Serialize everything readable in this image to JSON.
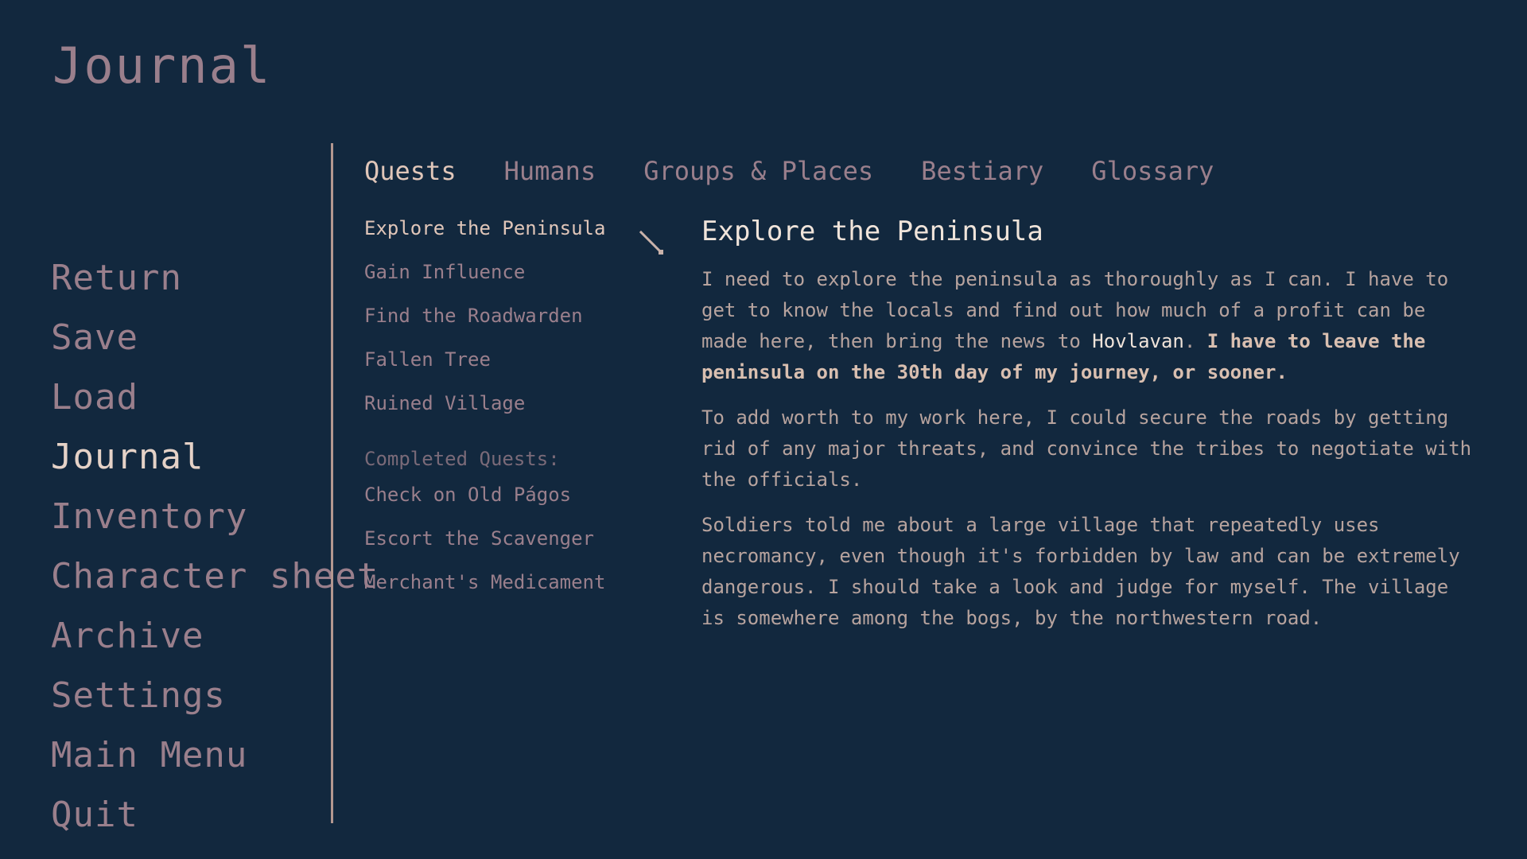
{
  "page": {
    "title": "Journal"
  },
  "main_menu": {
    "items": [
      {
        "label": "Return"
      },
      {
        "label": "Save"
      },
      {
        "label": "Load"
      },
      {
        "label": "Journal",
        "active": true
      },
      {
        "label": "Inventory"
      },
      {
        "label": "Character sheet"
      },
      {
        "label": "Archive"
      },
      {
        "label": "Settings"
      },
      {
        "label": "Main Menu"
      },
      {
        "label": "Quit"
      }
    ]
  },
  "tabs": [
    {
      "label": "Quests",
      "active": true
    },
    {
      "label": "Humans"
    },
    {
      "label": "Groups & Places"
    },
    {
      "label": "Bestiary"
    },
    {
      "label": "Glossary"
    }
  ],
  "quests": {
    "active": [
      {
        "label": "Explore the Peninsula",
        "selected": true
      },
      {
        "label": "Gain Influence"
      },
      {
        "label": "Find the Roadwarden"
      },
      {
        "label": "Fallen Tree"
      },
      {
        "label": "Ruined Village"
      }
    ],
    "completed_heading": "Completed Quests:",
    "completed": [
      {
        "label": "Check on Old Págos"
      },
      {
        "label": "Escort the Scavenger"
      },
      {
        "label": "Merchant's Medicament"
      }
    ]
  },
  "detail": {
    "title": "Explore the Peninsula",
    "p1_a": "I need to explore the peninsula as thoroughly as I can. I have to get to know the locals and find out how much of a profit can be made here, then bring the news to ",
    "p1_place": "Hovlavan",
    "p1_b": ". ",
    "p1_bold": "I have to leave the peninsula on the 30th day of my journey, or sooner.",
    "p2": "To add worth to my work here, I could secure the roads by getting rid of any major threats, and convince the tribes to negotiate with the officials.",
    "p3": "Soldiers told me about a large village that repeatedly uses necromancy, even though it's forbidden by law and can be extremely dangerous. I should take a look and judge for myself. The village is somewhere among the bogs, by the northwestern road."
  },
  "icons": {
    "pointer": "quill-pointer-icon"
  },
  "colors": {
    "background": "#12283e",
    "text_muted": "#9a7f8c",
    "text_active": "#e5d2c7",
    "divider": "#b39790"
  }
}
